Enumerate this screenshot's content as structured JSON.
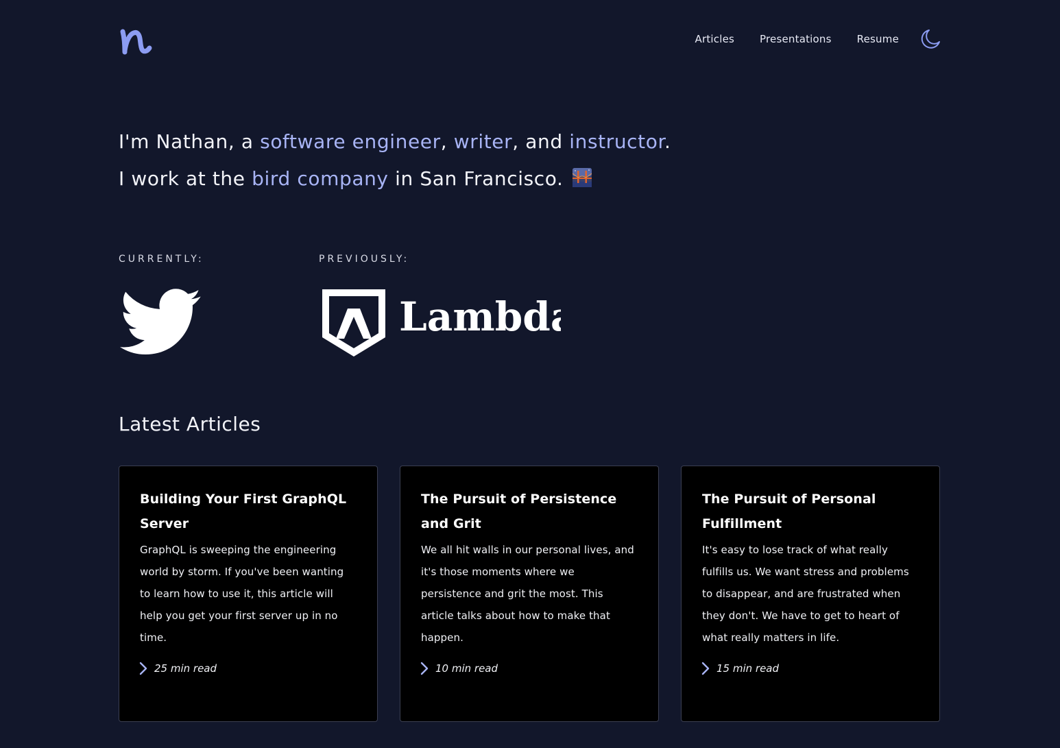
{
  "nav": {
    "items": [
      {
        "label": "Articles"
      },
      {
        "label": "Presentations"
      },
      {
        "label": "Resume"
      }
    ],
    "theme_toggle_icon": "moon-icon"
  },
  "hero": {
    "line1": {
      "prefix": "I'm Nathan, a ",
      "role1": "software engineer",
      "sep1": ", ",
      "role2": "writer",
      "sep2": ", and ",
      "role3": "instructor",
      "suffix": "."
    },
    "line2": {
      "prefix": "I work at the ",
      "company": "bird company",
      "suffix": " in San Francisco."
    },
    "emoji_icon": "bridge-at-night-icon"
  },
  "companies": {
    "current_label": "CURRENTLY:",
    "current_logo": "twitter-bird-icon",
    "previous_label": "PREVIOUSLY:",
    "previous_name": "Lambda"
  },
  "articles": {
    "heading": "Latest Articles",
    "items": [
      {
        "title": "Building Your First GraphQL Server",
        "description": "GraphQL is sweeping the engineering world by storm. If you've been wanting to learn how to use it, this article will help you get your first server up in no time.",
        "read_time": "25 min read"
      },
      {
        "title": "The Pursuit of Persistence and Grit",
        "description": "We all hit walls in our personal lives, and it's those moments where we persistence and grit the most. This article talks about how to make that happen.",
        "read_time": "10 min read"
      },
      {
        "title": "The Pursuit of Personal Fulfillment",
        "description": "It's easy to lose track of what really fulfills us. We want stress and problems to disappear, and are frustrated when they don't. We have to get to heart of what really matters in life.",
        "read_time": "15 min read"
      }
    ]
  },
  "colors": {
    "background": "#12172b",
    "accent": "#a8b4f5",
    "logo": "#8c9cf2",
    "card_background": "#000000"
  }
}
